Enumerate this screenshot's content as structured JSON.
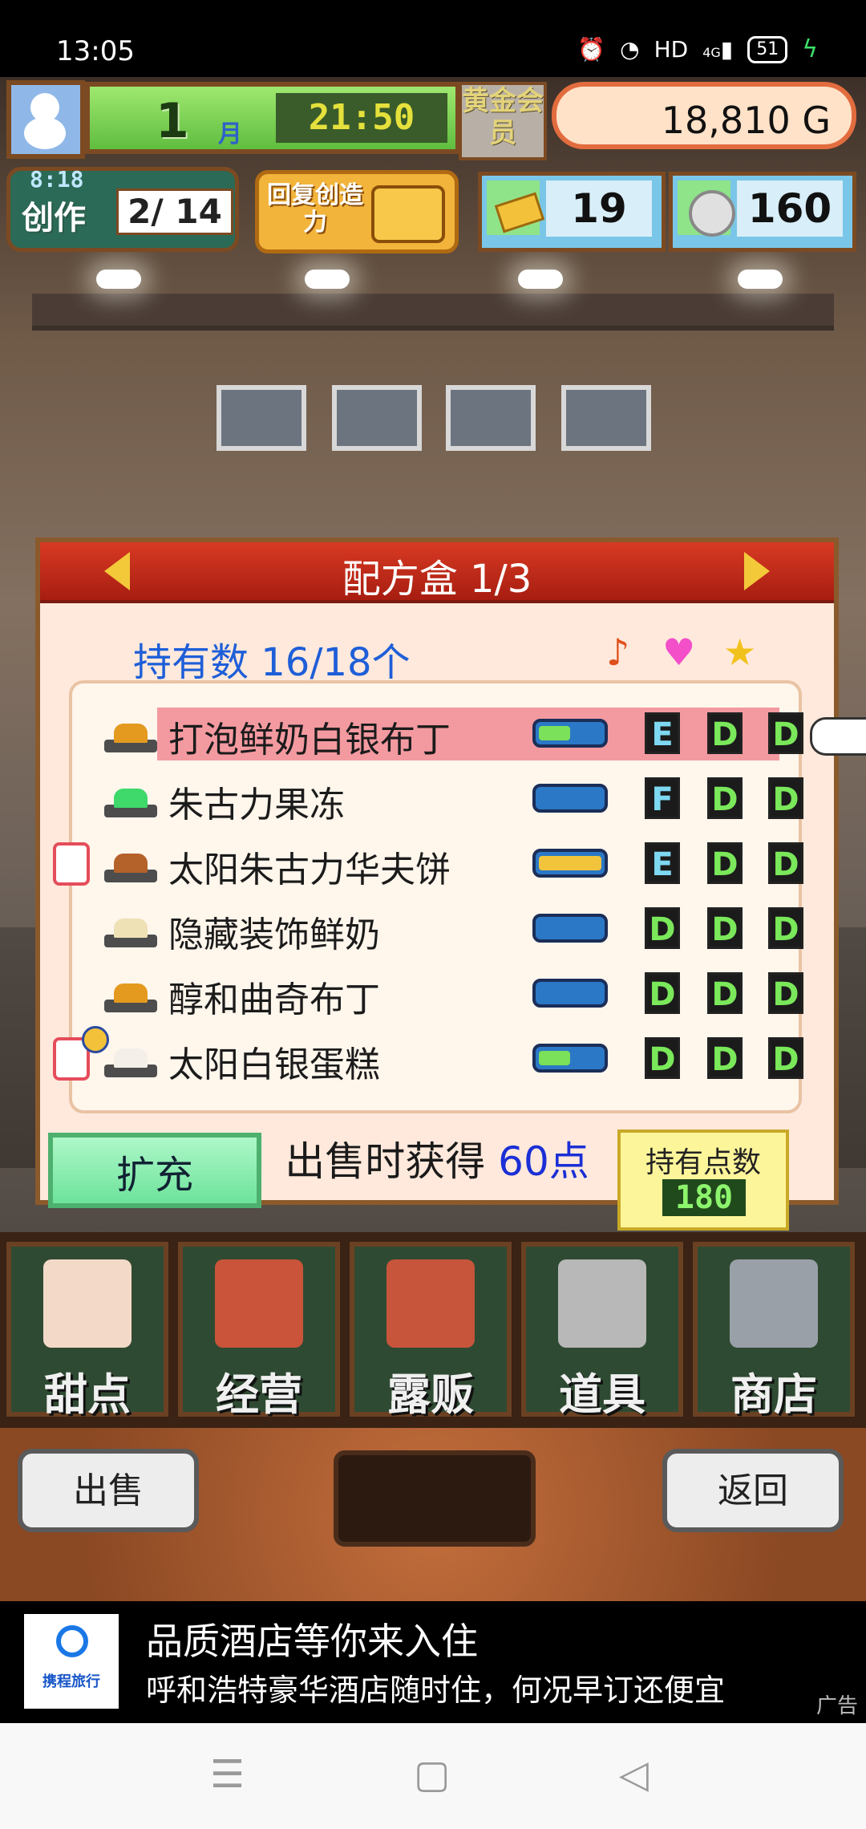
{
  "status_bar": {
    "time": "13:05",
    "network": "HD",
    "signal": "4G",
    "battery": "51"
  },
  "hud": {
    "month": "1",
    "month_label": "月",
    "clock": "21:50",
    "gold_member": "黄金会员",
    "money": "18,810 G",
    "create_timer": "8:18",
    "create_label": "创作",
    "create_progress": "2/ 14",
    "restore_label": "回复创造力",
    "tickets": "19",
    "medals": "160"
  },
  "panel": {
    "title": "配方盒 1/3",
    "owned": "持有数 16/18个",
    "header_icons": [
      "music-note-icon",
      "heart-icon",
      "star-icon"
    ],
    "recipes": [
      {
        "name": "打泡鲜奶白银布丁",
        "selected": true,
        "grades": [
          "E",
          "D",
          "D"
        ],
        "bar_level": 0.5,
        "bar_color": "#7be05a",
        "food_color": "#e39a1f",
        "chef": false,
        "medal": false
      },
      {
        "name": "朱古力果冻",
        "selected": false,
        "grades": [
          "F",
          "D",
          "D"
        ],
        "bar_level": 0,
        "bar_color": "#7be05a",
        "food_color": "#3fd86a",
        "chef": false,
        "medal": false
      },
      {
        "name": "太阳朱古力华夫饼",
        "selected": false,
        "grades": [
          "E",
          "D",
          "D"
        ],
        "bar_level": 1,
        "bar_color": "#f1c43b",
        "food_color": "#b5612a",
        "chef": true,
        "medal": false
      },
      {
        "name": "隐藏装饰鲜奶",
        "selected": false,
        "grades": [
          "D",
          "D",
          "D"
        ],
        "bar_level": 0,
        "bar_color": "#7be05a",
        "food_color": "#efe1b6",
        "chef": false,
        "medal": false
      },
      {
        "name": "醇和曲奇布丁",
        "selected": false,
        "grades": [
          "D",
          "D",
          "D"
        ],
        "bar_level": 0,
        "bar_color": "#7be05a",
        "food_color": "#e39a1f",
        "chef": false,
        "medal": false
      },
      {
        "name": "太阳白银蛋糕",
        "selected": false,
        "grades": [
          "D",
          "D",
          "D"
        ],
        "bar_level": 0.5,
        "bar_color": "#7be05a",
        "food_color": "#f4efe8",
        "chef": true,
        "medal": true
      }
    ],
    "bonus_prefix": "出售时获得 ",
    "bonus_points": "60点"
  },
  "expand_label": "扩充",
  "points": {
    "label": "持有点数",
    "value": "180"
  },
  "menu": [
    {
      "label": "甜点",
      "icon": "cake-icon"
    },
    {
      "label": "经营",
      "icon": "shop-icon"
    },
    {
      "label": "露贩",
      "icon": "food-truck-icon"
    },
    {
      "label": "道具",
      "icon": "items-bag-icon"
    },
    {
      "label": "商店",
      "icon": "cart-icon"
    }
  ],
  "sell_label": "出售",
  "back_label": "返回",
  "ad": {
    "brand": "携程旅行",
    "line1": "品质酒店等你来入住",
    "line2": "呼和浩特豪华酒店随时住，何况早订还便宜",
    "tag": "广告"
  },
  "colors": {
    "panel_header": "#c32a18",
    "owned_text": "#1e5ed8",
    "selected_row": "#f39aa0"
  }
}
